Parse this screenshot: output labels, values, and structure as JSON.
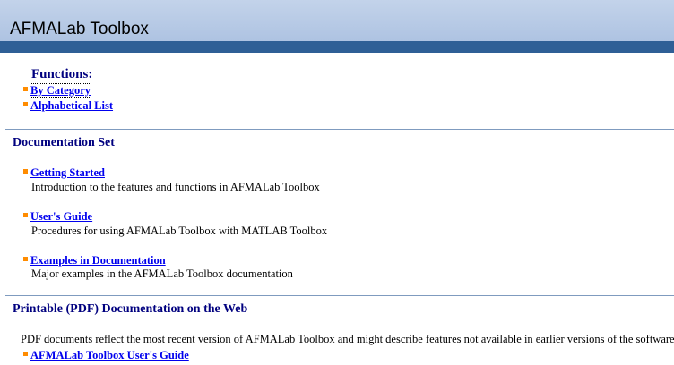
{
  "header": {
    "title": "AFMALab Toolbox"
  },
  "functions": {
    "heading": "Functions:",
    "links": [
      {
        "label": "By Category"
      },
      {
        "label": "Alphabetical List"
      }
    ]
  },
  "documentation_set": {
    "heading": "Documentation Set",
    "items": [
      {
        "label": "Getting Started",
        "description": "Introduction to the features and functions in AFMALab Toolbox"
      },
      {
        "label": "User's Guide",
        "description": "Procedures for using AFMALab Toolbox with MATLAB Toolbox"
      },
      {
        "label": "Examples in Documentation",
        "description": "Major examples in the AFMALab Toolbox documentation"
      }
    ]
  },
  "pdf_section": {
    "heading": "Printable (PDF) Documentation on the Web",
    "description": "PDF documents reflect the most recent version of AFMALab Toolbox and might describe features not available in earlier versions of the software.",
    "links": [
      {
        "label": "AFMALab Toolbox User's Guide"
      }
    ]
  },
  "colors": {
    "header_band": "#aec3e2",
    "header_bar": "#2f5f96",
    "heading_text": "#00007f",
    "link": "#0000ee",
    "bullet": "#ff8c00"
  }
}
